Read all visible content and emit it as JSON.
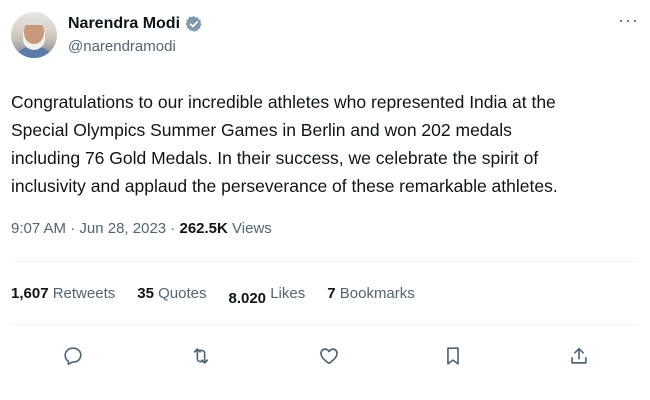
{
  "author": {
    "name": "Narendra Modi",
    "handle": "@narendramodi"
  },
  "more_label": "···",
  "tweet": {
    "text_lines": [
      "Congratulations to our incredible athletes who represented India at the",
      "Special Olympics Summer Games in Berlin and won 202 medals",
      "including 76 Gold Medals. In their success, we celebrate the spirit of",
      "inclusivity and applaud the perseverance of these remarkable athletes."
    ]
  },
  "meta": {
    "time": "9:07 AM",
    "sep": " · ",
    "date": "Jun 28, 2023",
    "sep2": " · ",
    "views_count": "262.5K",
    "views_label": "Views"
  },
  "stats": {
    "retweets_count": "1,607",
    "retweets_label": "Retweets",
    "quotes_count": "35",
    "quotes_label": "Quotes",
    "likes_count": "8.020",
    "likes_label": "Likes",
    "bookmarks_count": "7",
    "bookmarks_label": "Bookmarks"
  },
  "actions": [
    "reply-icon",
    "retweet-icon",
    "like-icon",
    "bookmark-icon",
    "share-icon"
  ],
  "colors": {
    "text": "#0f1419",
    "secondary": "#536471",
    "verified": "#829aab",
    "divider": "#eff3f4"
  }
}
